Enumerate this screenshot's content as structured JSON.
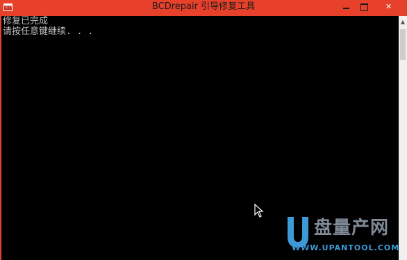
{
  "window": {
    "title": "BCDrepair 引导修复工具",
    "title_bar_color": "#e8412b"
  },
  "controls": {
    "minimize_icon": "minimize-icon",
    "maximize_icon": "maximize-icon",
    "close_label": "✕"
  },
  "console": {
    "lines": [
      "修复已完成",
      "请按任意键继续. . ."
    ],
    "text_color": "#c0c0c0",
    "background_color": "#000000"
  },
  "watermark": {
    "logo_text": "盘量产网",
    "url": "WWW.UPANTOOL.COM",
    "icon": "u-logo-icon"
  }
}
